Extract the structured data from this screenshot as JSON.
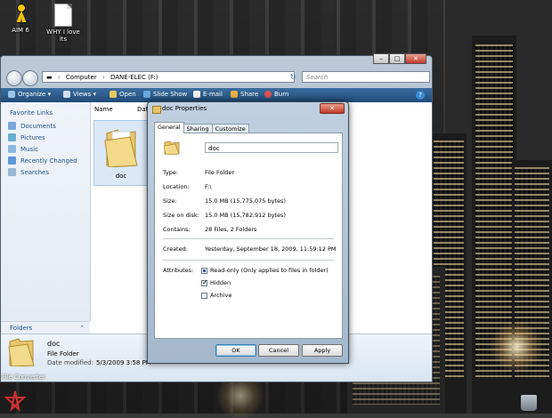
{
  "desktop": {
    "icons": [
      {
        "label": "AIM 6"
      },
      {
        "label": "WHY I love its"
      },
      {
        "label": "File Converter"
      }
    ]
  },
  "explorer": {
    "address": [
      "Computer",
      "DANE-ELEC (F:)"
    ],
    "search_placeholder": "Search",
    "toolbar": [
      "Organize",
      "Views",
      "Open",
      "Slide Show",
      "E-mail",
      "Share",
      "Burn"
    ],
    "help": "?",
    "favorite_links_title": "Favorite Links",
    "favorite_links": [
      "Documents",
      "Pictures",
      "Music",
      "Recently Changed",
      "Searches"
    ],
    "folders_label": "Folders",
    "columns": [
      "Name",
      "Dat"
    ],
    "item_label": "doc",
    "details": {
      "name": "doc",
      "type": "File Folder",
      "modified_label": "Date modified:",
      "modified_value": "5/3/2009 3:58 PM"
    }
  },
  "dialog": {
    "title": "doc Properties",
    "close": "✕",
    "tabs": [
      "General",
      "Sharing",
      "Customize"
    ],
    "name_value": "doc",
    "rows": {
      "type_k": "Type:",
      "type_v": "File Folder",
      "location_k": "Location:",
      "location_v": "F:\\",
      "size_k": "Size:",
      "size_v": "15.0 MB (15,775,075 bytes)",
      "sod_k": "Size on disk:",
      "sod_v": "15.0 MB (15,782,912 bytes)",
      "contains_k": "Contains:",
      "contains_v": "28 Files, 2 Folders",
      "created_k": "Created:",
      "created_v": "Yesterday, September 18, 2009, 11:59:12 PM",
      "attributes_k": "Attributes:"
    },
    "attributes": {
      "readonly": "Read-only (Only applies to files in folder)",
      "hidden": "Hidden",
      "archive": "Archive"
    },
    "buttons": {
      "ok": "OK",
      "cancel": "Cancel",
      "apply": "Apply"
    }
  }
}
